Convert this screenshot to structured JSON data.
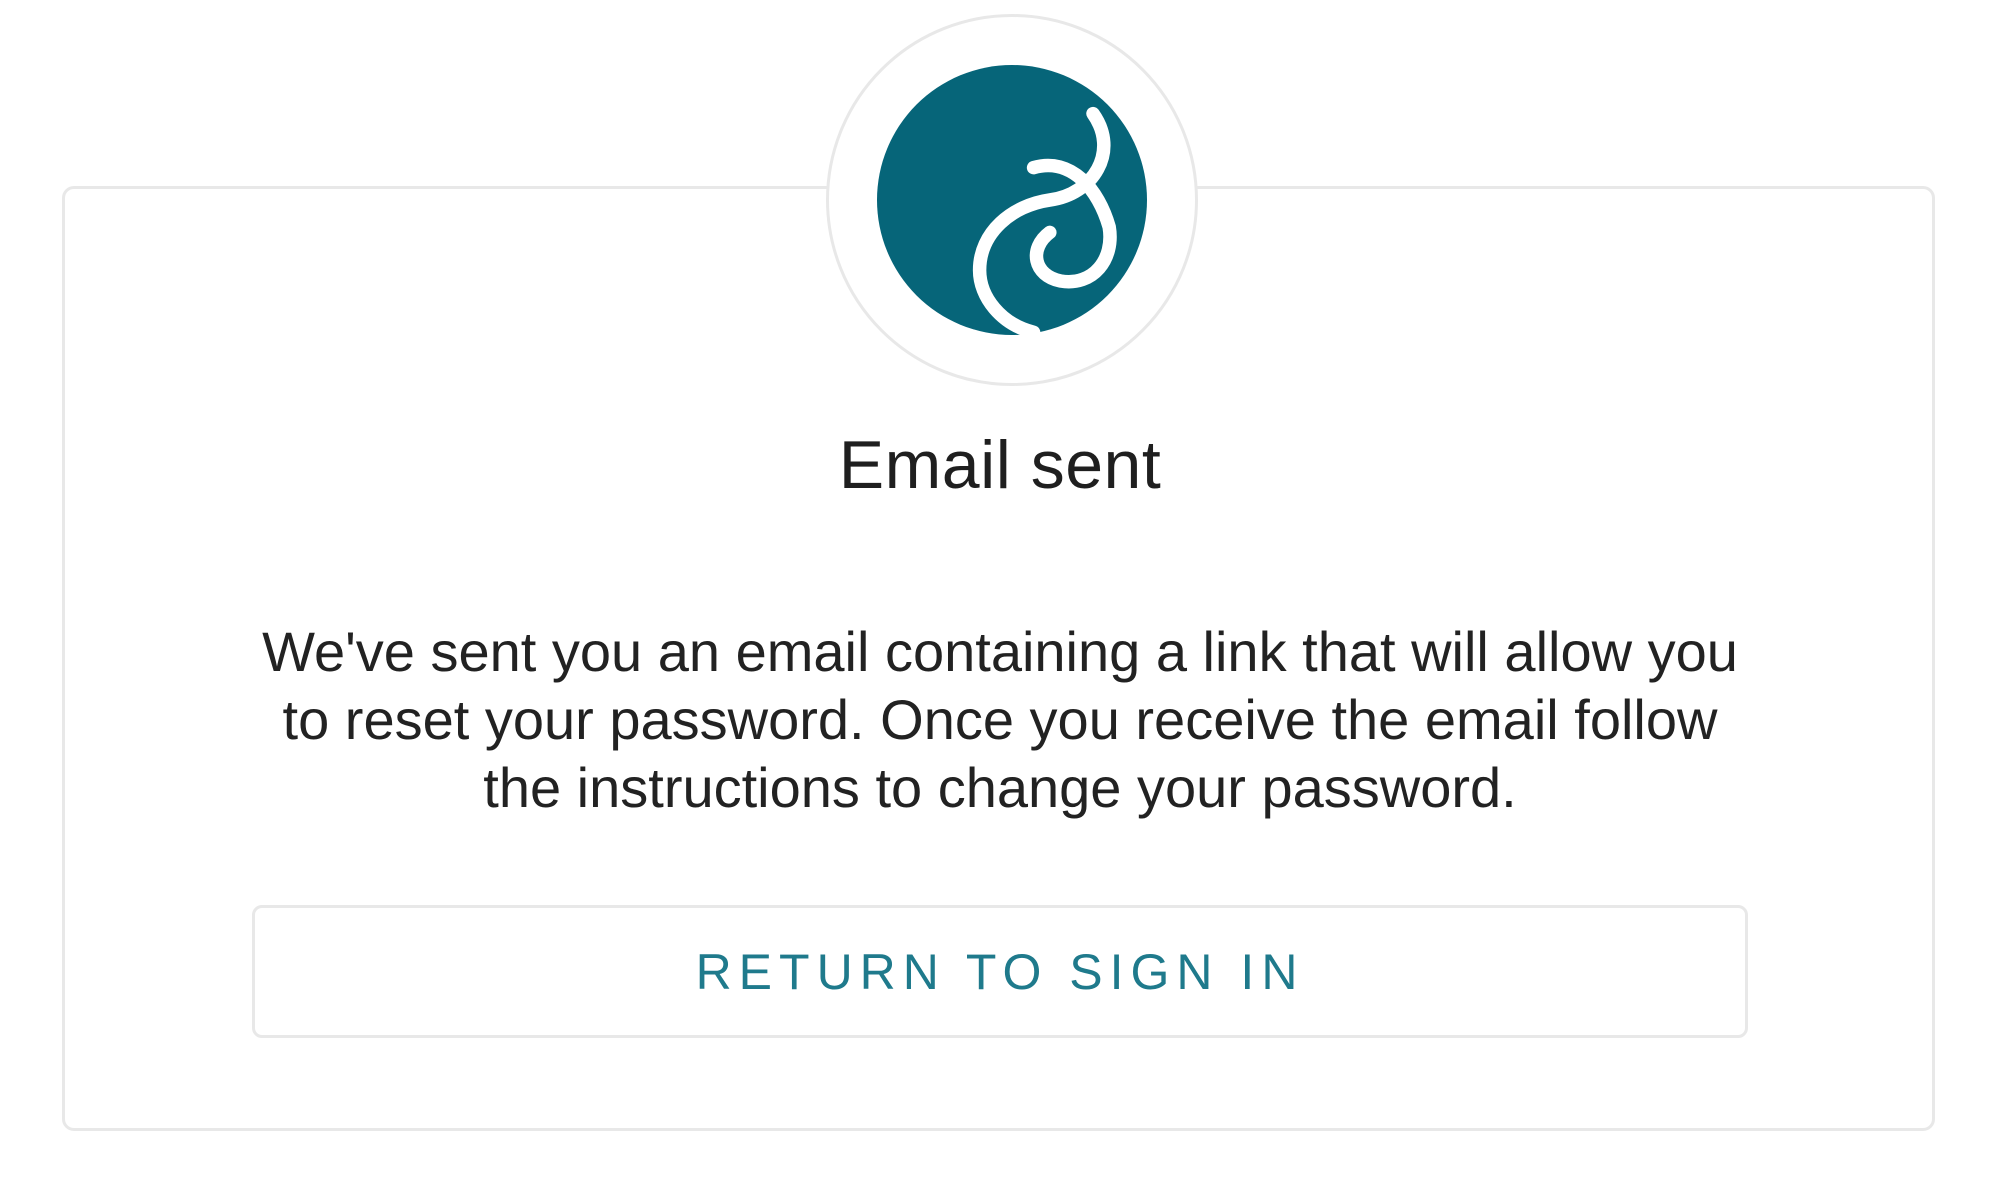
{
  "brand": {
    "accent_color": "#066579",
    "icon": "swirl-logo-icon"
  },
  "dialog": {
    "title": "Email sent",
    "message": "We've sent you an email containing a link that will allow you to reset your password. Once you receive the email follow the instructions to change your password.",
    "return_button_label": "RETURN TO SIGN IN"
  }
}
